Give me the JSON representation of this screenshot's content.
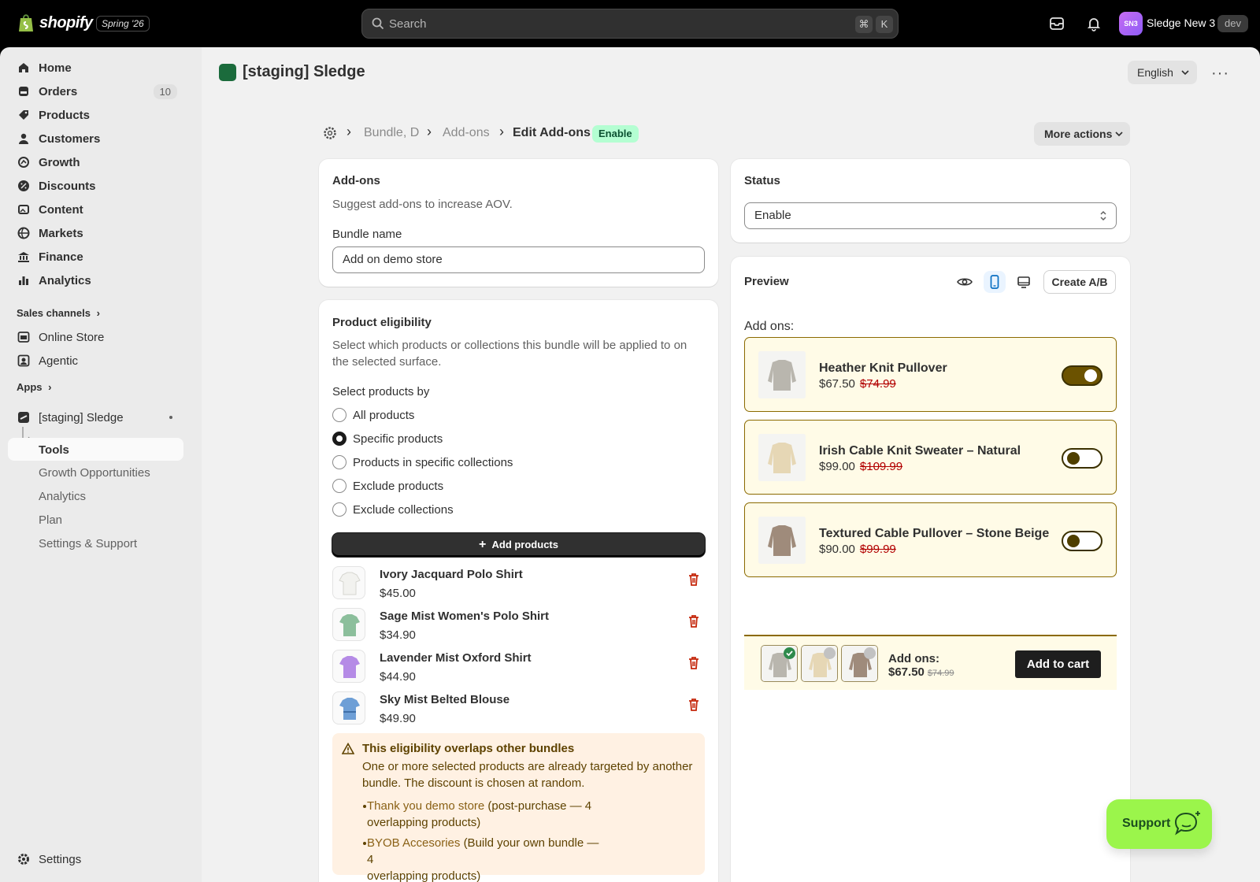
{
  "topbar": {
    "brand": "shopify",
    "edition": "Spring '26",
    "search_placeholder": "Search",
    "shortcut_key1": "⌘",
    "shortcut_key2": "K",
    "avatar_initials": "SN3",
    "store_name": "Sledge New 3",
    "env_badge": "dev"
  },
  "sidebar": {
    "items": [
      {
        "label": "Home",
        "icon": "home-icon"
      },
      {
        "label": "Orders",
        "icon": "orders-icon",
        "count": "10"
      },
      {
        "label": "Products",
        "icon": "tag-icon"
      },
      {
        "label": "Customers",
        "icon": "person-icon"
      },
      {
        "label": "Growth",
        "icon": "growth-icon"
      },
      {
        "label": "Discounts",
        "icon": "discount-icon"
      },
      {
        "label": "Content",
        "icon": "content-icon"
      },
      {
        "label": "Markets",
        "icon": "globe-icon"
      },
      {
        "label": "Finance",
        "icon": "bank-icon"
      },
      {
        "label": "Analytics",
        "icon": "bar-chart-icon"
      }
    ],
    "sales_channels_label": "Sales channels",
    "channels": [
      {
        "label": "Online Store",
        "icon": "store-icon"
      },
      {
        "label": "Agentic",
        "icon": "agentic-icon"
      }
    ],
    "apps_label": "Apps",
    "app": {
      "label": "[staging] Sledge",
      "subitems": [
        "Tools",
        "Growth Opportunities",
        "Analytics",
        "Plan",
        "Settings & Support"
      ]
    },
    "settings_label": "Settings"
  },
  "header": {
    "app_title": "[staging] Sledge",
    "language": "English"
  },
  "breadcrumb": {
    "crumb1": "Bundle, D",
    "crumb2": "Add-ons",
    "current": "Edit Add-ons",
    "status_badge": "Enable",
    "more_actions": "More actions"
  },
  "addons_card": {
    "title": "Add-ons",
    "description": "Suggest add-ons to increase AOV.",
    "bundle_name_label": "Bundle name",
    "bundle_name_value": "Add on demo store"
  },
  "eligibility_card": {
    "title": "Product eligibility",
    "description_line1": "Select which products or collections this bundle will be applied to on",
    "description_line2": "the selected surface.",
    "select_by_label": "Select products by",
    "options": [
      "All products",
      "Specific products",
      "Products in specific collections",
      "Exclude products",
      "Exclude collections"
    ],
    "selected_option": "Specific products",
    "add_products_label": "Add products",
    "products": [
      {
        "name": "Ivory Jacquard Polo Shirt",
        "price": "$45.00",
        "color": "#f2f2ef"
      },
      {
        "name": "Sage Mist Women's Polo Shirt",
        "price": "$34.90",
        "color": "#8cbf9c"
      },
      {
        "name": "Lavender Mist Oxford Shirt",
        "price": "$44.90",
        "color": "#b58be6"
      },
      {
        "name": "Sky Mist Belted Blouse",
        "price": "$49.90",
        "color": "#6e9fd6"
      }
    ],
    "warning": {
      "title": "This eligibility overlaps other bundles",
      "body_line1": "One or more selected products are already targeted by another",
      "body_line2": "bundle. The discount is chosen at random.",
      "bullet1_link": "Thank you demo store",
      "bullet1_rest_line1": "(post-purchase — 4",
      "bullet1_rest_line2": "overlapping products)",
      "bullet2_link": "BYOB Accesories",
      "bullet2_rest_line1": "(Build your own bundle — 4",
      "bullet2_rest_line2": "overlapping products)"
    }
  },
  "status_card": {
    "title": "Status",
    "value": "Enable"
  },
  "preview_card": {
    "title": "Preview",
    "create_ab": "Create A/B",
    "addons_label": "Add ons:",
    "addons": [
      {
        "name": "Heather Knit Pullover",
        "price": "$67.50",
        "old_price": "$74.99",
        "enabled": true,
        "color": "#b9b6ae"
      },
      {
        "name": "Irish Cable Knit Sweater – Natural",
        "price": "$99.00",
        "old_price": "$109.99",
        "enabled": false,
        "color": "#e6d7b5"
      },
      {
        "name": "Textured Cable Pullover – Stone Beige",
        "price": "$90.00",
        "old_price": "$99.99",
        "enabled": false,
        "color": "#9f8b7b"
      }
    ],
    "sticky": {
      "label": "Add ons:",
      "price": "$67.50",
      "old_price": "$74.99",
      "add_to_cart": "Add to cart"
    }
  },
  "support_button": {
    "label": "Support"
  },
  "colors": {
    "accent_green": "#9bf54b",
    "addon_border": "#8b6a00",
    "addon_bg": "#fffbe7",
    "strike_red": "#b20000",
    "warning_bg": "#fff1e3"
  }
}
